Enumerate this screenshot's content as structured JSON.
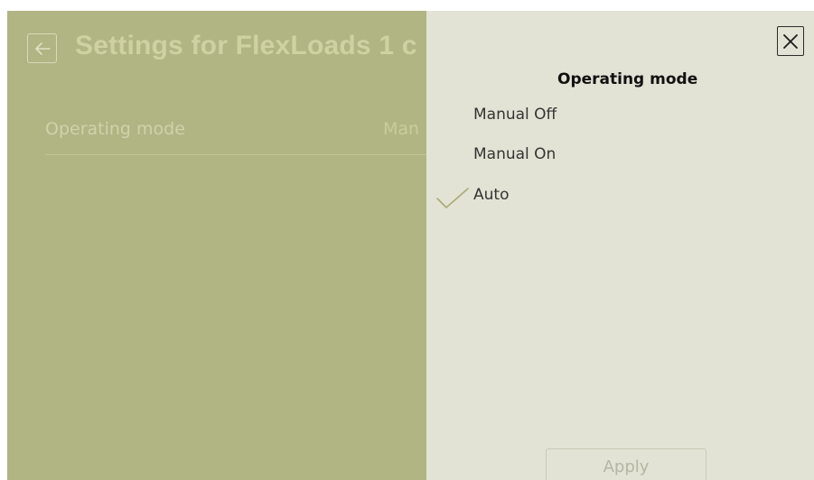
{
  "page": {
    "title": "Settings for FlexLoads 1 c",
    "back_icon": "arrow-left-icon"
  },
  "settings": {
    "rows": [
      {
        "label": "Operating mode",
        "value": "Man"
      }
    ]
  },
  "panel": {
    "title": "Operating mode",
    "close_icon": "close-icon",
    "options": [
      {
        "label": "Manual Off",
        "selected": false
      },
      {
        "label": "Manual On",
        "selected": false
      },
      {
        "label": "Auto",
        "selected": true
      }
    ],
    "selected_icon": "checkmark-icon",
    "apply_label": "Apply"
  },
  "colors": {
    "overlay_background": "#b1b483",
    "panel_background": "#e3e3d5",
    "check_color": "#a8ab78"
  }
}
